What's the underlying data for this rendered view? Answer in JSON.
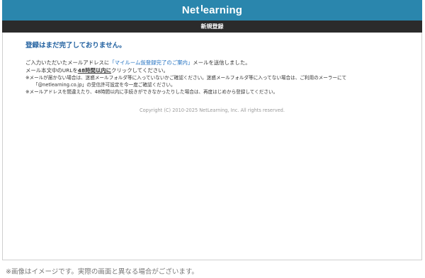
{
  "header": {
    "logo_text_a": "Net",
    "logo_text_b": "earning",
    "title": "新規登録"
  },
  "message": {
    "heading": "登録はまだ完了しておりません。",
    "line1_pre": "ご入力いただいたメールアドレスに",
    "line1_link": "「マイルーム仮登録完了のご案内」",
    "line1_post": "メールを送信しました。",
    "line2_pre": "メール本文中のURLを",
    "line2_emph": "48時間以内に",
    "line2_post": "クリックしてください。",
    "note1": "※メールが届かない場合は、迷惑メールフォルダ等に入っていないかご確認ください。迷惑メールフォルダ等に入ってない場合は、ご利用のメーラーにて",
    "note1b": "「@netlearning.co.jp」の受信許可設定を今一度ご確認ください。",
    "note2": "※メールアドレスを間違えたり、48時間以内に手続きができなかったりした場合は、再度はじめから登録してください。"
  },
  "footer": {
    "copyright": "Copyright (C) 2010-2025 NetLearning, Inc. All rights reserved."
  },
  "caption": "※画像はイメージです。実際の画面と異なる場合がございます。",
  "colors": {
    "brand": "#2a86ad",
    "titlebar": "#2b2b2b",
    "heading": "#1f5f9f"
  }
}
